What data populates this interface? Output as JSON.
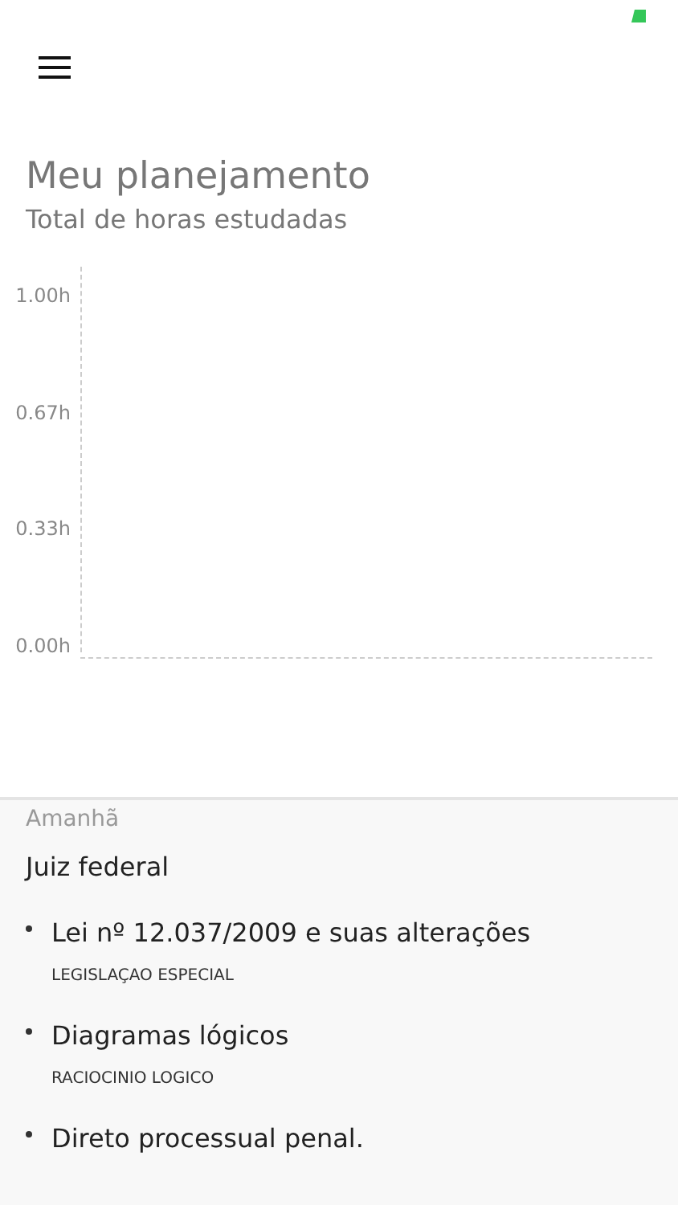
{
  "title": "Meu planejamento",
  "subtitle": "Total de horas estudadas",
  "chart": {
    "y_labels": [
      "1.00h",
      "0.67h",
      "0.33h",
      "0.00h"
    ]
  },
  "schedule": {
    "day": "Amanhã",
    "course": "Juiz federal",
    "topics": [
      {
        "title": "Lei nº 12.037/2009 e suas alterações",
        "subject": "LEGISLAÇAO ESPECIAL"
      },
      {
        "title": "Diagramas lógicos",
        "subject": "RACIOCINIO LOGICO"
      },
      {
        "title": "Direto processual penal."
      }
    ]
  }
}
